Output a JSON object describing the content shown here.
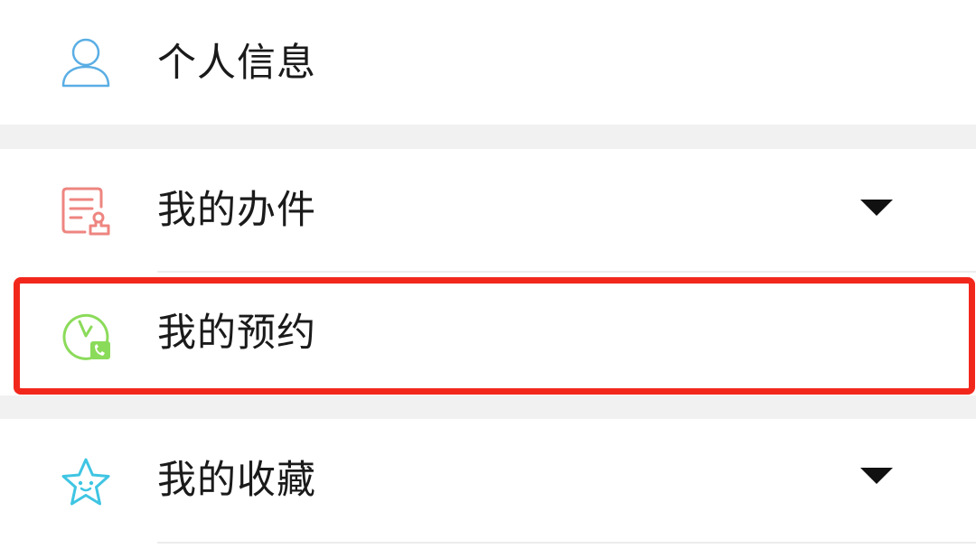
{
  "menu": {
    "items": [
      {
        "label": "个人信息",
        "icon": "person-icon",
        "expandable": false
      },
      {
        "label": "我的办件",
        "icon": "document-stamp-icon",
        "expandable": true
      },
      {
        "label": "我的预约",
        "icon": "clock-phone-icon",
        "expandable": false,
        "highlighted": true
      },
      {
        "label": "我的收藏",
        "icon": "star-icon",
        "expandable": true
      }
    ]
  },
  "colors": {
    "person_icon": "#5aaee4",
    "document_icon": "#ee8580",
    "clock_icon": "#8bdb5a",
    "star_icon": "#3fc5e3",
    "highlight": "#f2271c",
    "section_gap": "#f1f1f1",
    "text": "#1a1a1a"
  }
}
